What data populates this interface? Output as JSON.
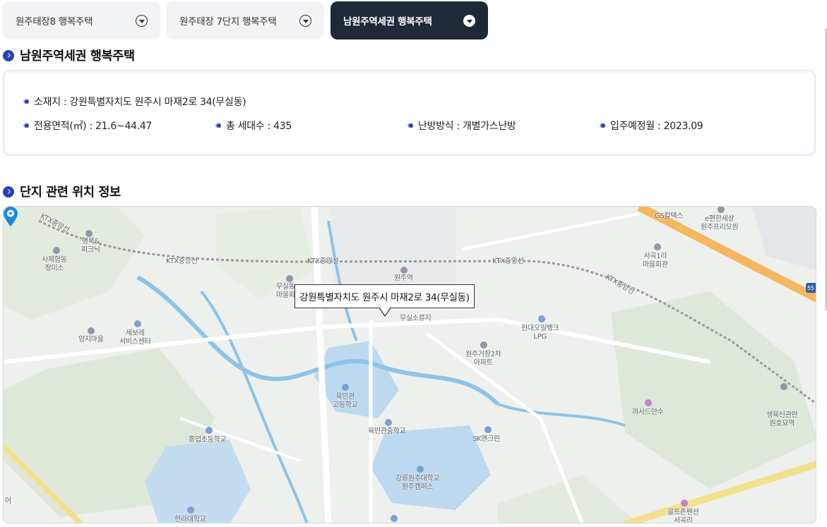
{
  "tabs": [
    {
      "label": "원주태장8 행복주택",
      "active": false
    },
    {
      "label": "원주태장 7단지 행복주택",
      "active": false
    },
    {
      "label": "남원주역세권 행복주택",
      "active": true
    }
  ],
  "complex": {
    "title": "남원주역세권 행복주택",
    "address": "소재지 : 강원특별자치도 원주시 마재2로 34(무실동)",
    "area": "전용면적(㎡) : 21.6~44.47",
    "households": "총 세대수 : 435",
    "heating": "난방방식 : 개별가스난방",
    "move_in": "입주예정월 : 2023.09"
  },
  "location": {
    "title": "단지 관련 위치 정보",
    "popup": "강원특별자치도 원주시 마재2로 34(무실동)"
  },
  "map_labels": {
    "ktx1": "KTX중앙선",
    "ktx2": "KTX중앙선",
    "ktx3": "KTX중앙선",
    "ktx4": "KTX중앙선",
    "ktx5": "KTX중앙선",
    "haengbok": "행복&\n피크닉",
    "sajae": "사제협동\n정미소",
    "yangji": "양지마을",
    "sebore": "세보레\n서비스센터",
    "musil_maeul": "무실동\n마을회",
    "wonju_station": "원주역",
    "musil_fire": "무실소류지",
    "hyundai_oil": "현대오일뱅크\nLPG",
    "geojang": "원주거장2차\n아파트",
    "gs": "GS칼텍스",
    "epyeon": "e편한세상\n원주프리모원",
    "seogok": "서곡1리\n마을회관",
    "yukmin_high": "육민관\n고등학교",
    "yukmin_mid": "육민관중학교",
    "sk": "SK엔크린",
    "heungeop": "흥업초등학교",
    "gangneung_univ": "강릉원주대학교\n원주캠퍼스",
    "kkasade": "까사드만수",
    "saengyuk": "생육신관란\n원호묘역",
    "golf": "골프존펜션\n서곡리",
    "halla": "한라대학교",
    "eo": "어",
    "route55": "55"
  },
  "colors": {
    "accent": "#2b3fb8",
    "active_tab": "#1f2937",
    "pin": "#1e88e5",
    "highway": "#f5b75f",
    "water": "#bcd9f0",
    "river": "#8cc3e8"
  }
}
